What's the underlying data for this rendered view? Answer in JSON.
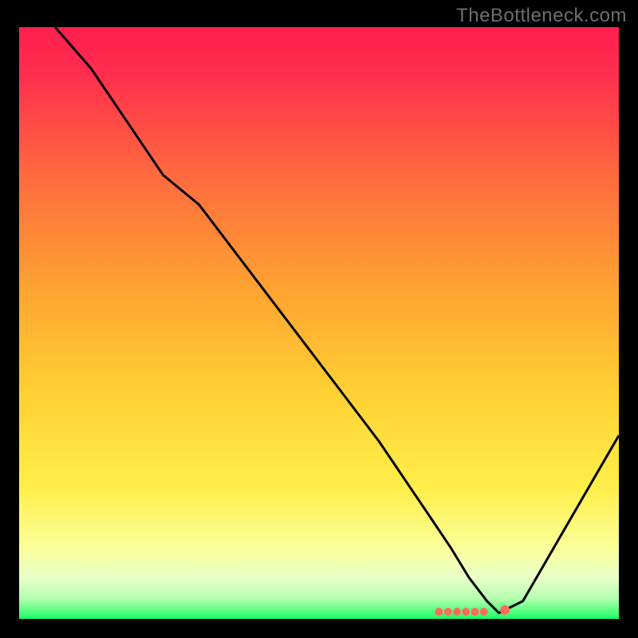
{
  "watermark": "TheBottleneck.com",
  "colors": {
    "bg": "#000000",
    "watermark": "#6e6e6e",
    "curve": "#000000",
    "dot_fill": "#ff6b5a",
    "gradient_top": "#ff1f4f",
    "gradient_mid": "#ffb000",
    "gradient_low": "#ffff6a",
    "gradient_pale": "#f8ffd8",
    "gradient_bottom": "#1bff66"
  },
  "chart_data": {
    "type": "line",
    "title": "",
    "xlabel": "",
    "ylabel": "",
    "xlim": [
      0,
      100
    ],
    "ylim": [
      0,
      100
    ],
    "series": [
      {
        "name": "bottleneck-curve",
        "x": [
          6,
          12,
          18,
          24,
          30,
          36,
          42,
          48,
          54,
          60,
          64,
          68,
          72,
          75,
          78,
          80,
          84,
          88,
          92,
          96,
          100
        ],
        "y": [
          100,
          93,
          84,
          75,
          70,
          62,
          54,
          46,
          38,
          30,
          24,
          18,
          12,
          7,
          3,
          1,
          3,
          10,
          17,
          24,
          31
        ]
      }
    ],
    "markers": {
      "name": "optimal-range-dots",
      "x": [
        70,
        71.5,
        73,
        74.5,
        76,
        77.5,
        81
      ],
      "y": [
        1.2,
        1.2,
        1.2,
        1.2,
        1.2,
        1.2,
        1.5
      ],
      "r": [
        5,
        5,
        5,
        5,
        5,
        5,
        6
      ]
    },
    "gradient_stops": [
      {
        "offset": 0.0,
        "color": "#ff1f4f"
      },
      {
        "offset": 0.08,
        "color": "#ff2e4e"
      },
      {
        "offset": 0.25,
        "color": "#ff6a3f"
      },
      {
        "offset": 0.45,
        "color": "#ffa531"
      },
      {
        "offset": 0.62,
        "color": "#ffd133"
      },
      {
        "offset": 0.78,
        "color": "#ffef4a"
      },
      {
        "offset": 0.88,
        "color": "#fbff9a"
      },
      {
        "offset": 0.93,
        "color": "#e9ffc8"
      },
      {
        "offset": 0.965,
        "color": "#b6ffb0"
      },
      {
        "offset": 1.0,
        "color": "#1bff66"
      }
    ]
  }
}
